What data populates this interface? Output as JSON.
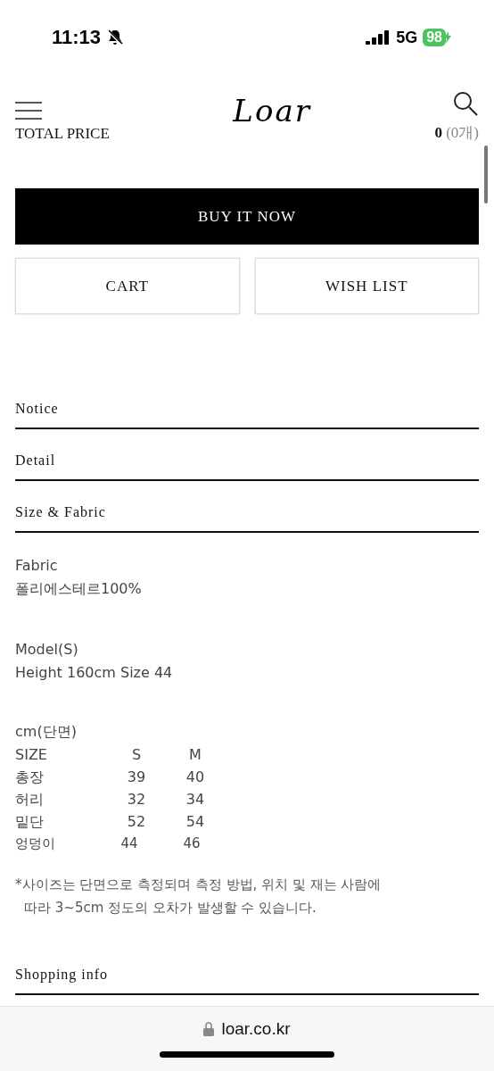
{
  "status_bar": {
    "time": "11:13",
    "network": "5G",
    "battery": "98"
  },
  "header": {
    "total_price_label": "TOTAL PRICE",
    "logo": "Loar",
    "cart_count": "0",
    "cart_items": "(0개)"
  },
  "actions": {
    "buy_now": "BUY IT NOW",
    "cart": "CART",
    "wish_list": "WISH LIST"
  },
  "sections": [
    {
      "title": "Notice"
    },
    {
      "title": "Detail"
    },
    {
      "title": "Size & Fabric"
    }
  ],
  "fabric": {
    "label": "Fabric",
    "value": "폴리에스테르100%"
  },
  "model": {
    "label": "Model(S)",
    "value": "Height 160cm Size 44"
  },
  "size_table": {
    "unit": "cm(단면)",
    "rows": [
      {
        "kind": "header",
        "cells": [
          "SIZE",
          "S",
          "M"
        ]
      },
      {
        "kind": "regular",
        "cells": [
          "총장",
          "39",
          "40"
        ]
      },
      {
        "kind": "regular",
        "cells": [
          "허리",
          "32",
          "34"
        ]
      },
      {
        "kind": "regular",
        "cells": [
          "밑단",
          "52",
          "54"
        ]
      },
      {
        "kind": "shifted",
        "cells": [
          "엉덩이",
          "44",
          "46"
        ]
      }
    ]
  },
  "note": [
    "*사이즈는 단면으로 측정되며 측정 방법, 위치 및 재는 사람에",
    "따라 3~5cm 정도의 오차가 발생할 수 있습니다."
  ],
  "shopping_info": {
    "title": "Shopping info"
  },
  "browser_bar": {
    "url": "loar.co.kr"
  }
}
